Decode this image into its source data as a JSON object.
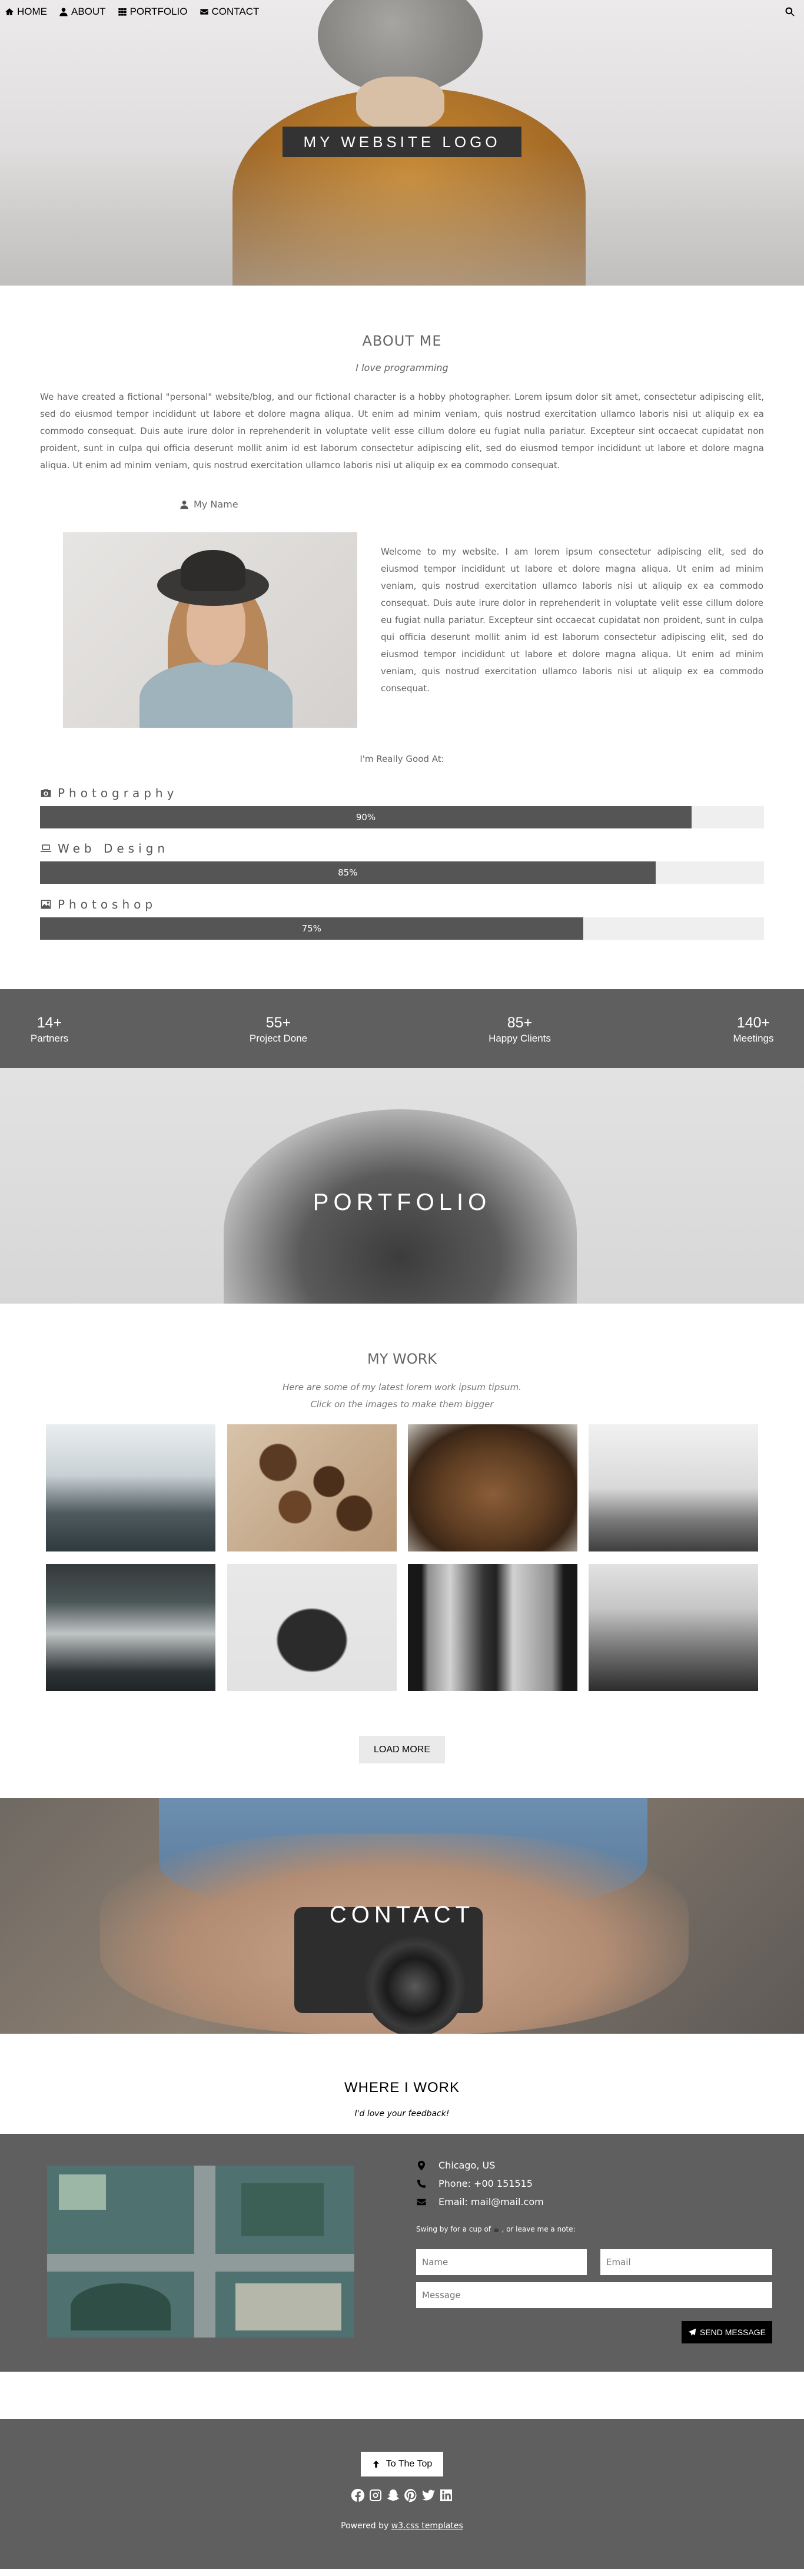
{
  "nav": {
    "items": [
      {
        "label": "HOME",
        "icon": "home-icon"
      },
      {
        "label": "ABOUT",
        "icon": "user-icon"
      },
      {
        "label": "PORTFOLIO",
        "icon": "th-icon"
      },
      {
        "label": "CONTACT",
        "icon": "envelope-icon"
      }
    ],
    "search_icon": "search-icon"
  },
  "hero": {
    "logo": "MY WEBSITE LOGO"
  },
  "about": {
    "title": "ABOUT ME",
    "subtitle": "I love programming",
    "paragraph": "We have created a fictional \"personal\" website/blog, and our fictional character is a hobby photographer. Lorem ipsum dolor sit amet, consectetur adipiscing elit, sed do eiusmod tempor incididunt ut labore et dolore magna aliqua. Ut enim ad minim veniam, quis nostrud exercitation ullamco laboris nisi ut aliquip ex ea commodo consequat. Duis aute irure dolor in reprehenderit in voluptate velit esse cillum dolore eu fugiat nulla pariatur. Excepteur sint occaecat cupidatat non proident, sunt in culpa qui officia deserunt mollit anim id est laborum consectetur adipiscing elit, sed do eiusmod tempor incididunt ut labore et dolore magna aliqua. Ut enim ad minim veniam, quis nostrud exercitation ullamco laboris nisi ut aliquip ex ea commodo consequat.",
    "name_label": "My Name",
    "welcome": "Welcome to my website. I am lorem ipsum consectetur adipiscing elit, sed do eiusmod tempor incididunt ut labore et dolore magna aliqua. Ut enim ad minim veniam, quis nostrud exercitation ullamco laboris nisi ut aliquip ex ea commodo consequat. Duis aute irure dolor in reprehenderit in voluptate velit esse cillum dolore eu fugiat nulla pariatur. Excepteur sint occaecat cupidatat non proident, sunt in culpa qui officia deserunt mollit anim id est laborum consectetur adipiscing elit, sed do eiusmod tempor incididunt ut labore et dolore magna aliqua. Ut enim ad minim veniam, quis nostrud exercitation ullamco laboris nisi ut aliquip ex ea commodo consequat.",
    "good_at": "I'm Really Good At:",
    "skills": [
      {
        "name": "Photography",
        "icon": "camera-icon",
        "value": 90,
        "label": "90%"
      },
      {
        "name": "Web Design",
        "icon": "laptop-icon",
        "value": 85,
        "label": "85%"
      },
      {
        "name": "Photoshop",
        "icon": "image-icon",
        "value": 75,
        "label": "75%"
      }
    ]
  },
  "stats": [
    {
      "number": "14+",
      "label": "Partners"
    },
    {
      "number": "55+",
      "label": "Project Done"
    },
    {
      "number": "85+",
      "label": "Happy Clients"
    },
    {
      "number": "140+",
      "label": "Meetings"
    }
  ],
  "portfolio": {
    "banner": "PORTFOLIO"
  },
  "work": {
    "title": "MY WORK",
    "sub1": "Here are some of my latest lorem work ipsum tipsum.",
    "sub2": "Click on the images to make them bigger",
    "load_more": "LOAD MORE"
  },
  "contact_banner": "CONTACT",
  "where": {
    "title": "WHERE I WORK",
    "subtitle": "I'd love your feedback!"
  },
  "contact": {
    "location": "Chicago, US",
    "phone": "Phone: +00 151515",
    "email": "Email: mail@mail.com",
    "note_pre": "Swing by for a cup of",
    "note_post": ", or leave me a note:",
    "name_placeholder": "Name",
    "email_placeholder": "Email",
    "message_placeholder": "Message",
    "send": "SEND MESSAGE"
  },
  "footer": {
    "top": "To The Top",
    "powered_pre": "Powered by",
    "powered_link": "w3.css templates"
  },
  "colors": {
    "dark_gray": "#5f5f5f",
    "bar": "#555555",
    "track": "#efefef"
  }
}
